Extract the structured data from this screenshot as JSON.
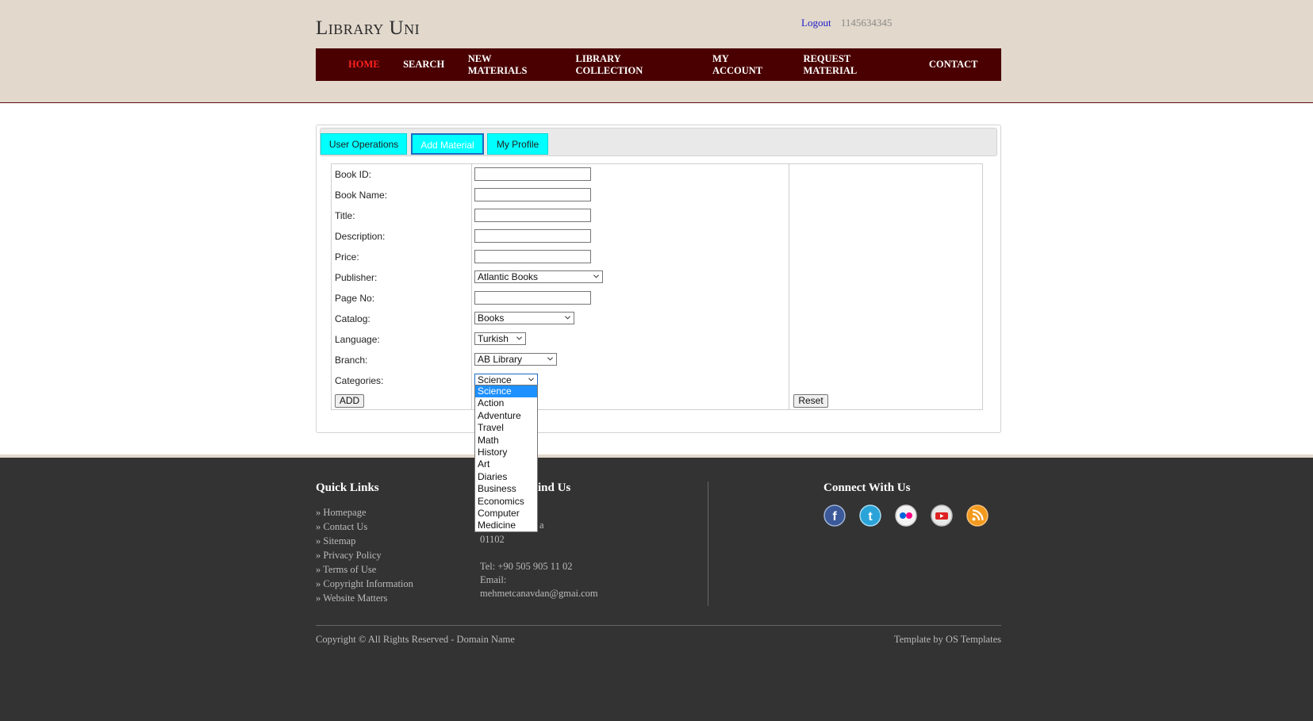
{
  "header": {
    "logo": "Library Uni",
    "logout": "Logout",
    "user_id": "1145634345"
  },
  "nav": {
    "items": [
      {
        "label": "HOME",
        "active": true
      },
      {
        "label": "SEARCH"
      },
      {
        "label": "NEW MATERIALS"
      },
      {
        "label": "LIBRARY COLLECTION"
      },
      {
        "label": "MY ACCOUNT"
      },
      {
        "label": "REQUEST MATERIAL"
      },
      {
        "label": "CONTACT"
      }
    ]
  },
  "tabs": {
    "user_operations": "User Operations",
    "add_material": "Add Material",
    "my_profile": "My Profile",
    "active": "Add Material"
  },
  "form": {
    "labels": {
      "book_id": "Book ID:",
      "book_name": "Book Name:",
      "title": "Title:",
      "description": "Description:",
      "price": "Price:",
      "publisher": "Publisher:",
      "page_no": "Page No:",
      "catalog": "Catalog:",
      "language": "Language:",
      "branch": "Branch:",
      "categories": "Categories:"
    },
    "values": {
      "book_id": "",
      "book_name": "",
      "title": "",
      "description": "",
      "price": "",
      "page_no": ""
    },
    "selects": {
      "publisher": "Atlantic Books",
      "catalog": "Books",
      "language": "Turkish",
      "branch": "AB Library",
      "categories": "Science"
    },
    "add_button": "ADD",
    "reset_button": "Reset"
  },
  "categories_dropdown": {
    "options": [
      "Science",
      "Action",
      "Adventure",
      "Travel",
      "Math",
      "History",
      "Art",
      "Diaries",
      "Business",
      "Economics",
      "Computer",
      "Medicine"
    ],
    "selected": "Science"
  },
  "footer": {
    "quick_links_heading": "Quick Links",
    "quick_links": [
      "» Homepage",
      "» Contact Us",
      "» Sitemap",
      "» Privacy Policy",
      "» Terms of Use",
      "» Copyright Information",
      "» Website Matters"
    ],
    "find_us_heading_visible": "ind Us",
    "address_partial": "a",
    "postal": "01102",
    "tel": "Tel: +90 505 905 11 02",
    "email_label": "Email:",
    "email": "mehmetcanavdan@gmai.com",
    "connect_heading": "Connect With Us",
    "social_icons": [
      "facebook-icon",
      "twitter-icon",
      "flickr-icon",
      "youtube-icon",
      "rss-icon"
    ],
    "copyright": "Copyright © All Rights Reserved - Domain Name",
    "template_by": "Template by OS Templates"
  },
  "colors": {
    "header_bg": "#e2d8cc",
    "nav_bg": "#4a0000",
    "nav_active": "#ff2222",
    "tab_bg": "#00ffff",
    "footer_bg": "#333333",
    "dropdown_selected": "#1e90ff"
  }
}
